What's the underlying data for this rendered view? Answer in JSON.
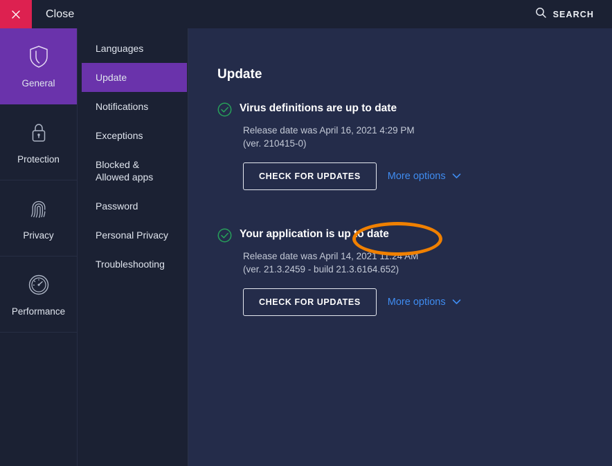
{
  "titlebar": {
    "close_label": "Close",
    "close_icon": "close-icon",
    "search_label": "SEARCH",
    "search_icon": "search-icon"
  },
  "rail": {
    "items": [
      {
        "label": "General",
        "icon": "shield-icon",
        "active": true
      },
      {
        "label": "Protection",
        "icon": "lock-icon",
        "active": false
      },
      {
        "label": "Privacy",
        "icon": "fingerprint-icon",
        "active": false
      },
      {
        "label": "Performance",
        "icon": "gauge-icon",
        "active": false
      }
    ]
  },
  "submenu": {
    "items": [
      {
        "label": "Languages",
        "active": false
      },
      {
        "label": "Update",
        "active": true
      },
      {
        "label": "Notifications",
        "active": false
      },
      {
        "label": "Exceptions",
        "active": false
      },
      {
        "label": "Blocked & Allowed apps",
        "active": false
      },
      {
        "label": "Password",
        "active": false
      },
      {
        "label": "Personal Privacy",
        "active": false
      },
      {
        "label": "Troubleshooting",
        "active": false
      }
    ]
  },
  "main": {
    "page_title": "Update",
    "blocks": [
      {
        "status_icon": "check-circle-icon",
        "title": "Virus definitions are up to date",
        "release_line": "Release date was April 16, 2021 4:29 PM",
        "version_line": "(ver. 210415-0)",
        "button_label": "CHECK FOR UPDATES",
        "more_label": "More options"
      },
      {
        "status_icon": "check-circle-icon",
        "title": "Your application is up to date",
        "release_line": "Release date was April 14, 2021 11:24 AM",
        "version_line": "(ver. 21.3.2459 - build 21.3.6164.652)",
        "button_label": "CHECK FOR UPDATES",
        "more_label": "More options"
      }
    ]
  },
  "colors": {
    "accent_purple": "#6a33ab",
    "close_red": "#dd2150",
    "link_blue": "#3f8cf0",
    "status_green": "#27a05a",
    "annotation_orange": "#f08000",
    "panel_dark": "#1b2133",
    "content_bg": "#242c4a"
  }
}
